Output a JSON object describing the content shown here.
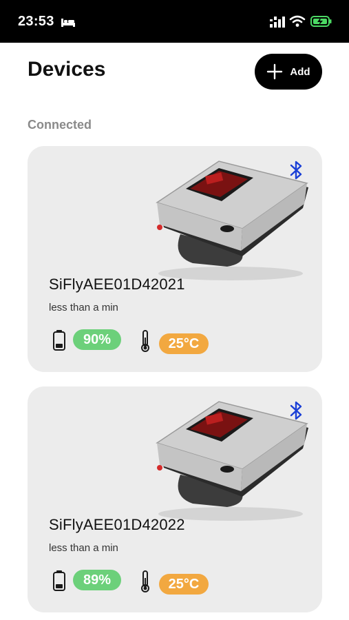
{
  "status_bar": {
    "time": "23:53",
    "icons": [
      "bed-icon",
      "cellular-signal-icon",
      "wifi-icon",
      "battery-charging-icon"
    ]
  },
  "header": {
    "title": "Devices",
    "add_label": "Add"
  },
  "section": {
    "label": "Connected"
  },
  "devices": [
    {
      "name": "SiFlyAEE01D42021",
      "last_seen": "less than a min",
      "battery": "90%",
      "temperature": "25°C"
    },
    {
      "name": "SiFlyAEE01D42022",
      "last_seen": "less than a min",
      "battery": "89%",
      "temperature": "25°C"
    }
  ],
  "colors": {
    "battery_badge": "#6cd07a",
    "temp_badge": "#f2a840",
    "bluetooth": "#1a3fd6",
    "card_bg": "#ececec",
    "add_button_bg": "#000000"
  }
}
